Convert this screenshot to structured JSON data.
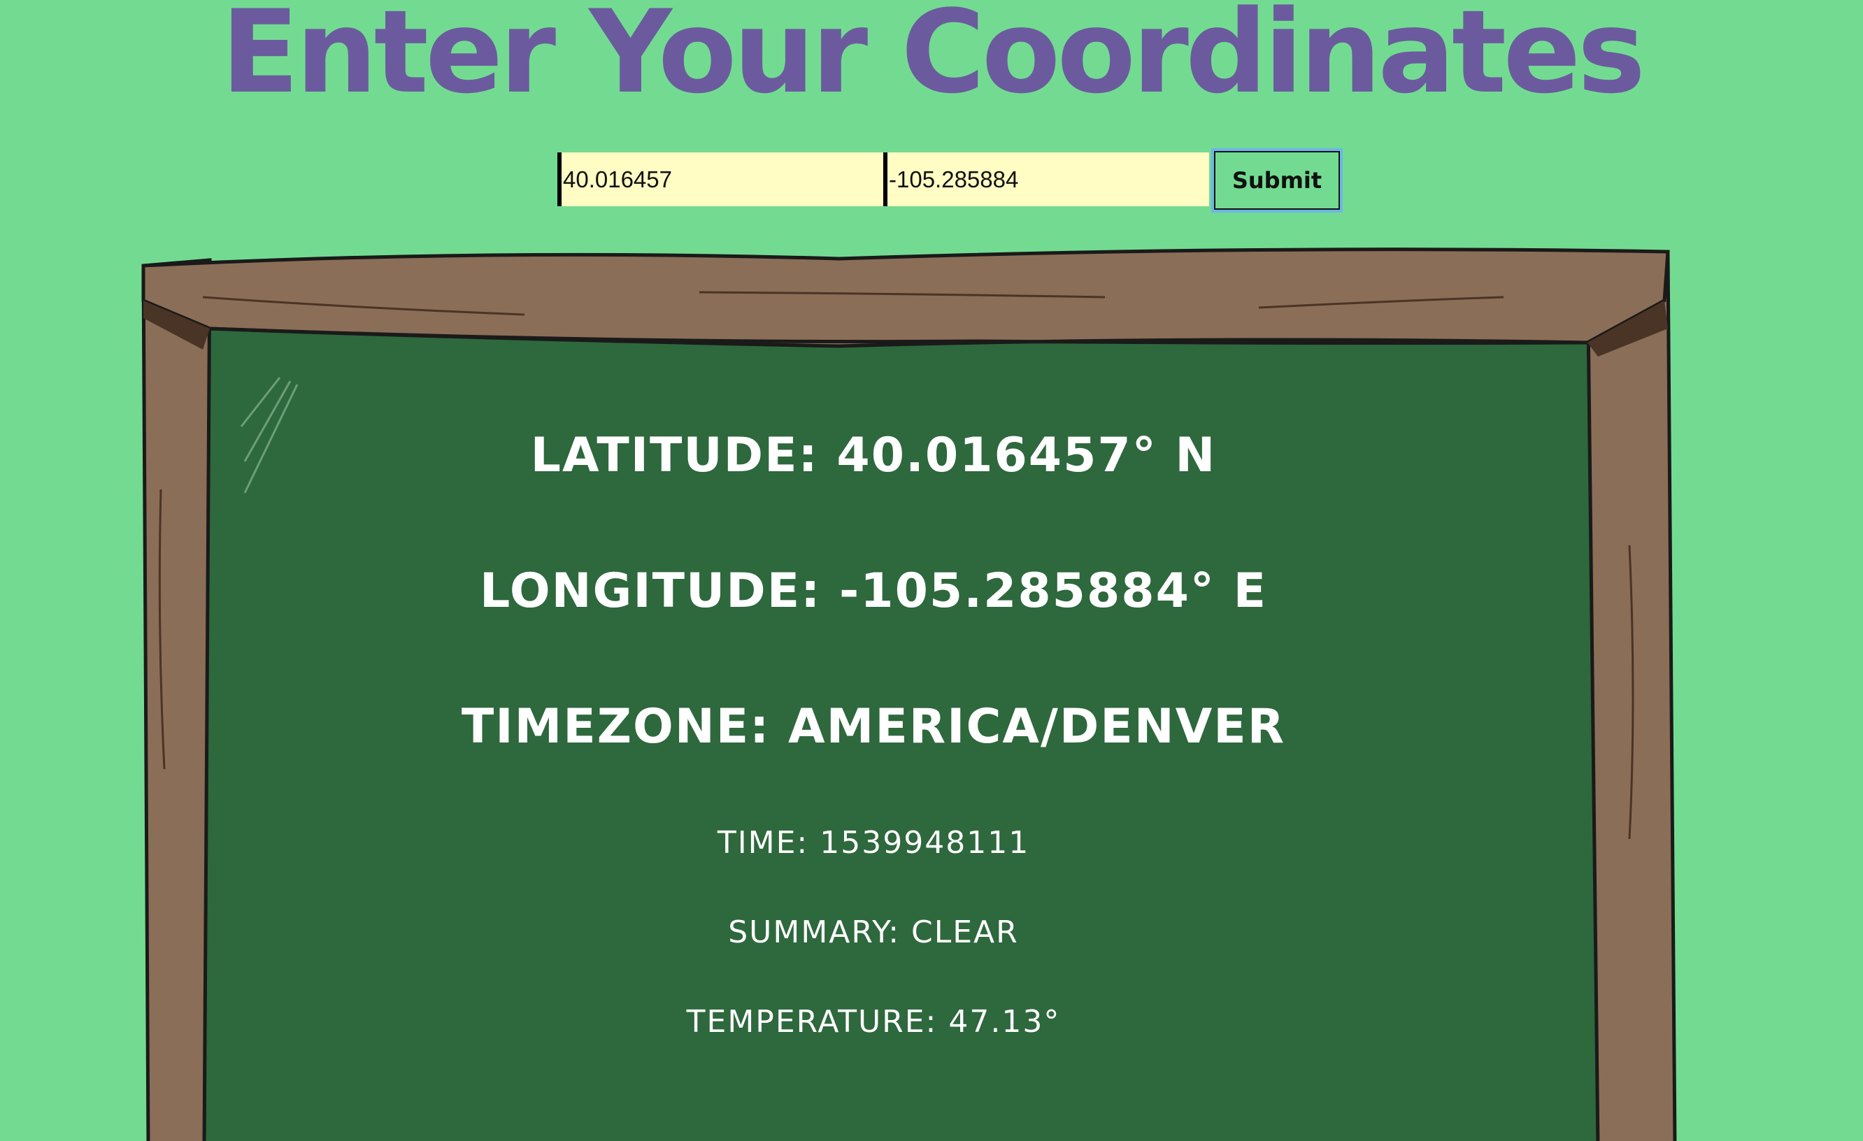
{
  "header": {
    "title": "Enter Your Coordinates"
  },
  "form": {
    "latitude_value": "40.016457",
    "longitude_value": "-105.285884",
    "submit_label": "Submit"
  },
  "board": {
    "latitude": "LATITUDE: 40.016457° N",
    "longitude": "LONGITUDE: -105.285884° E",
    "timezone": "TIMEZONE: AMERICA/DENVER",
    "time": "TIME: 1539948111",
    "summary": "SUMMARY: CLEAR",
    "temperature": "TEMPERATURE: 47.13°"
  },
  "colors": {
    "background": "#73db91",
    "title": "#6b5b9e",
    "input_bg": "#fffcc4",
    "chalkboard": "#2e683d",
    "frame": "#8b6e57",
    "chalk_text": "#ffffff"
  }
}
